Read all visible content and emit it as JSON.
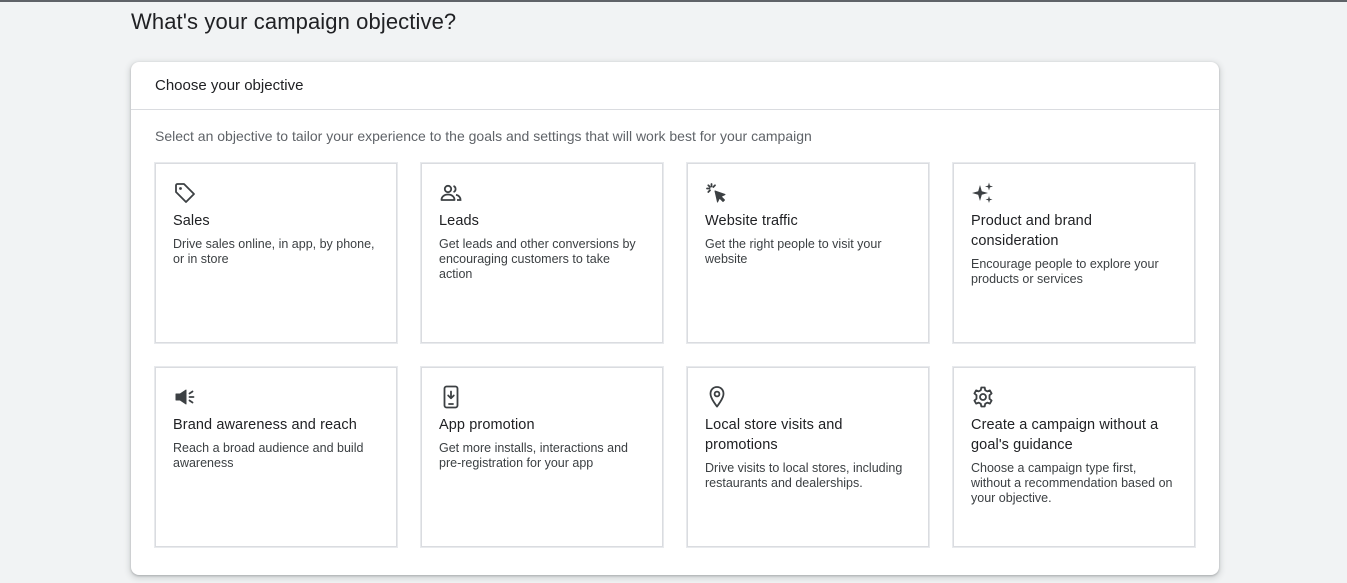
{
  "page": {
    "title": "What's your campaign objective?"
  },
  "panel": {
    "header_title": "Choose your objective",
    "subtitle": "Select an objective to tailor your experience to the goals and settings that will work best for your campaign"
  },
  "objectives": [
    {
      "icon": "tag-icon",
      "title": "Sales",
      "description": "Drive sales online, in app, by phone, or in store"
    },
    {
      "icon": "people-icon",
      "title": "Leads",
      "description": "Get leads and other conversions by encouraging customers to take action"
    },
    {
      "icon": "cursor-click-icon",
      "title": "Website traffic",
      "description": "Get the right people to visit your website"
    },
    {
      "icon": "sparkle-icon",
      "title": "Product and brand consideration",
      "description": "Encourage people to explore your products or services"
    },
    {
      "icon": "megaphone-icon",
      "title": "Brand awareness and reach",
      "description": "Reach a broad audience and build awareness"
    },
    {
      "icon": "phone-download-icon",
      "title": "App promotion",
      "description": "Get more installs, interactions and pre-registration for your app"
    },
    {
      "icon": "location-pin-icon",
      "title": "Local store visits and promotions",
      "description": "Drive visits to local stores, including restaurants and dealerships."
    },
    {
      "icon": "gear-icon",
      "title": "Create a campaign without a goal's guidance",
      "description": "Choose a campaign type first, without a recommendation based on your objective."
    }
  ],
  "colors": {
    "background": "#f1f3f4",
    "card_border": "#dadce0",
    "text_primary": "#202124",
    "text_secondary": "#5f6368",
    "icon": "#3c4043"
  }
}
